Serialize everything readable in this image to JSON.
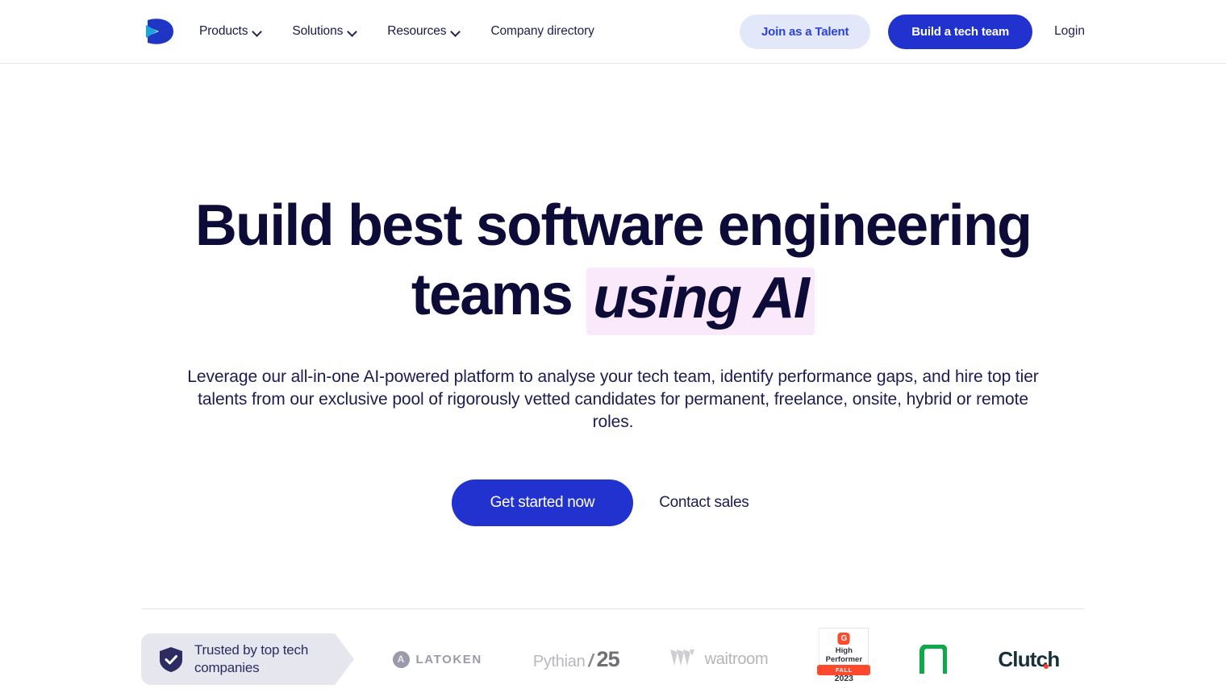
{
  "header": {
    "logo_name": "company-logo",
    "nav": [
      {
        "label": "Products",
        "has_dropdown": true
      },
      {
        "label": "Solutions",
        "has_dropdown": true
      },
      {
        "label": "Resources",
        "has_dropdown": true
      },
      {
        "label": "Company directory",
        "has_dropdown": false
      }
    ],
    "talent_button": "Join as a Talent",
    "build_button": "Build a tech team",
    "login_link": "Login"
  },
  "hero": {
    "heading_part1": "Build best software engineering teams ",
    "heading_highlight": "using AI",
    "subtitle": "Leverage our all-in-one AI-powered platform to analyse your tech team, identify performance gaps, and hire top tier talents from our exclusive pool of rigorously vetted candidates for permanent, freelance, onsite, hybrid or remote roles.",
    "primary_cta": "Get started now",
    "secondary_cta": "Contact sales"
  },
  "trust": {
    "badge_text": "Trusted by top tech companies",
    "logos": {
      "latoken": {
        "mark": "A",
        "text": "LATOKEN"
      },
      "pythian": {
        "name": "Pythian",
        "slash": "/",
        "number": "25"
      },
      "waitroom": {
        "text": "waitroom"
      },
      "g2": {
        "mark": "G",
        "title_line1": "High",
        "title_line2": "Performer",
        "season": "FALL",
        "year": "2023"
      },
      "nlogo": {
        "name": "n-logo"
      },
      "clutch": {
        "text": "Clutch"
      }
    }
  },
  "colors": {
    "brand_blue": "#2232cf",
    "logo_blue": "#1f35c4",
    "logo_cyan": "#1ba3dd",
    "ink": "#0d0b38",
    "highlight_pink": "#fae8fb",
    "talent_bg": "#e3e7fa",
    "badge_bg": "#e6e6ef",
    "g2_red": "#ff492c",
    "green": "#0fa94c"
  }
}
